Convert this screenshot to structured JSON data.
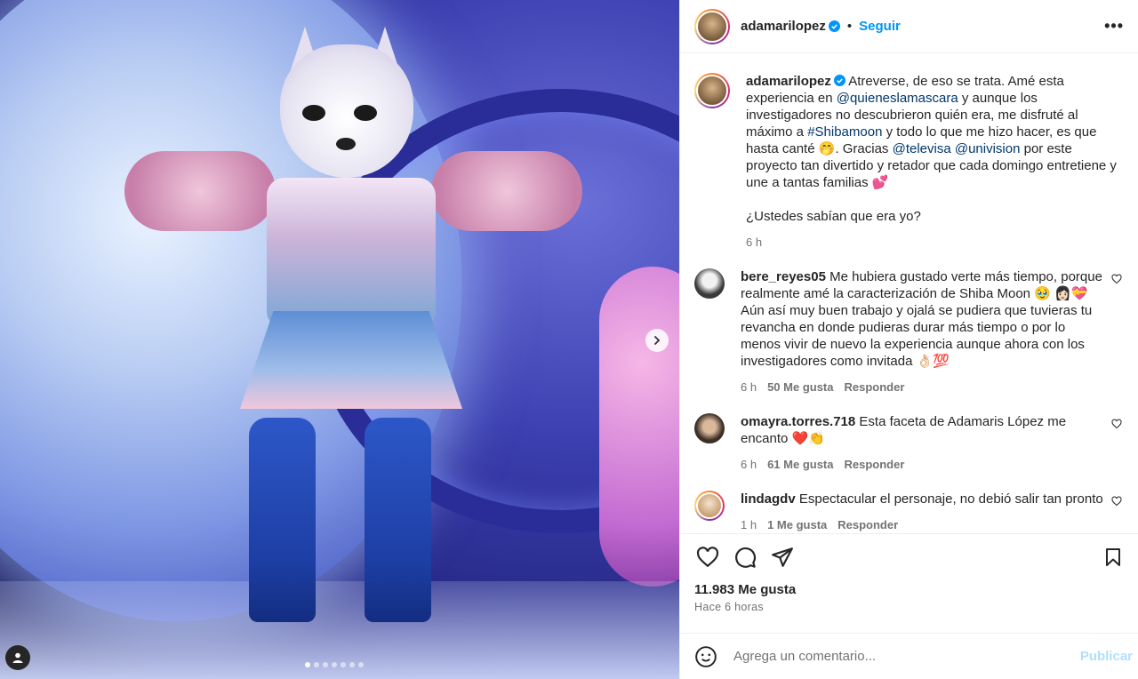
{
  "post": {
    "username": "adamarilopez",
    "follow_label": "Seguir",
    "separator": "•",
    "more_label": "•••",
    "caption": {
      "t1": "Atreverse, de eso se trata. Amé esta experiencia en ",
      "mention1": "@quieneslamascara",
      "t2": " y aunque los investigadores no descubrieron quién era, me disfruté al máximo a ",
      "hashtag": "#Shibamoon",
      "t3": " y todo lo que me hizo hacer, es que hasta canté 🤭. Gracias ",
      "mention2": "@televisa",
      "t4": " ",
      "mention3": "@univision",
      "t5": " por este proyecto tan divertido y retador que cada domingo entretiene y une a tantas familias 💕",
      "question": "¿Ustedes sabían que era yo?",
      "time": "6 h"
    },
    "comments": [
      {
        "user": "bere_reyes05",
        "text": "Me hubiera gustado verte más tiempo, porque realmente amé la caracterización de Shiba Moon 🥹 👩🏻💝 Aún así muy buen trabajo y ojalá se pudiera que tuvieras tu revancha en donde pudieras durar más tiempo o por lo menos vivir de nuevo la experiencia aunque ahora con los investigadores como invitada 👌🏻💯",
        "time": "6 h",
        "likes": "50 Me gusta",
        "reply": "Responder",
        "avatar_color": "#3a3a3a"
      },
      {
        "user": "omayra.torres.718",
        "text": "Esta faceta de Adamaris López me encanto ❤️👏",
        "time": "6 h",
        "likes": "61 Me gusta",
        "reply": "Responder",
        "avatar_color": "#5a4a40"
      },
      {
        "user": "lindagdv",
        "text": "Espectacular el personaje, no debió salir tan pronto",
        "time": "1 h",
        "likes": "1 Me gusta",
        "reply": "Responder",
        "avatar_color": "#c8a070"
      }
    ],
    "likes_total": "11.983 Me gusta",
    "posted_ago": "Hace 6 horas",
    "add_comment_placeholder": "Agrega un comentario...",
    "publish_label": "Publicar"
  },
  "carousel": {
    "count": 7,
    "active": 0
  },
  "icons": {
    "verified": "verified-badge-icon",
    "like": "heart-icon",
    "comment": "comment-icon",
    "share": "paper-plane-icon",
    "save": "bookmark-icon",
    "emoji": "smiley-icon",
    "next": "chevron-right-icon",
    "tags": "user-tag-icon"
  },
  "colors": {
    "link": "#00376b",
    "follow": "#0095f6",
    "publish_disabled": "#b2dffc",
    "verified": "#0095f6"
  }
}
